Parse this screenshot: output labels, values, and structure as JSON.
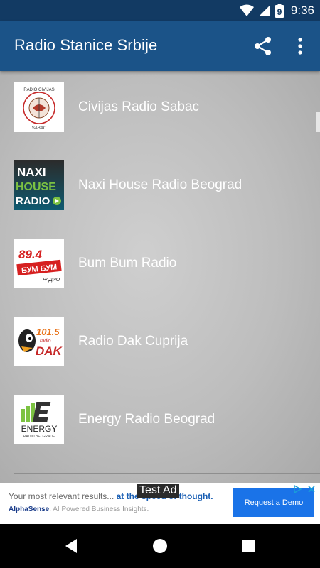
{
  "status_bar": {
    "time": "9:36",
    "battery_text": "9"
  },
  "toolbar": {
    "title": "Radio Stanice Srbije"
  },
  "stations": [
    {
      "name": "Civijas Radio Sabac",
      "logo_top": "RADIO CIVIJAS",
      "logo_bottom": "SABAC"
    },
    {
      "name": "Naxi House Radio Beograd",
      "logo_line1": "NAXI",
      "logo_line2": "HOUSE",
      "logo_line3": "RADIO"
    },
    {
      "name": "Bum Bum Radio",
      "logo_freq": "89.4",
      "logo_text": "БУМ БУМ",
      "logo_sub": "РАДИО"
    },
    {
      "name": "Radio Dak Cuprija",
      "logo_freq": "101.5",
      "logo_text": "DAK",
      "logo_sub": "radio"
    },
    {
      "name": "Energy Radio Beograd",
      "logo_text": "ENERGY",
      "logo_sub": "RADIO BELGRADE"
    }
  ],
  "ad": {
    "label": "Test Ad",
    "headline_start": "Your most relevant results... ",
    "headline_highlight": "at the speed of thought.",
    "brand": "AlphaSense",
    "tagline": ". AI Powered Business Insights.",
    "cta": "Request a Demo"
  },
  "colors": {
    "status_bar": "#123a63",
    "toolbar": "#1b5388",
    "cta": "#1a73e8"
  }
}
